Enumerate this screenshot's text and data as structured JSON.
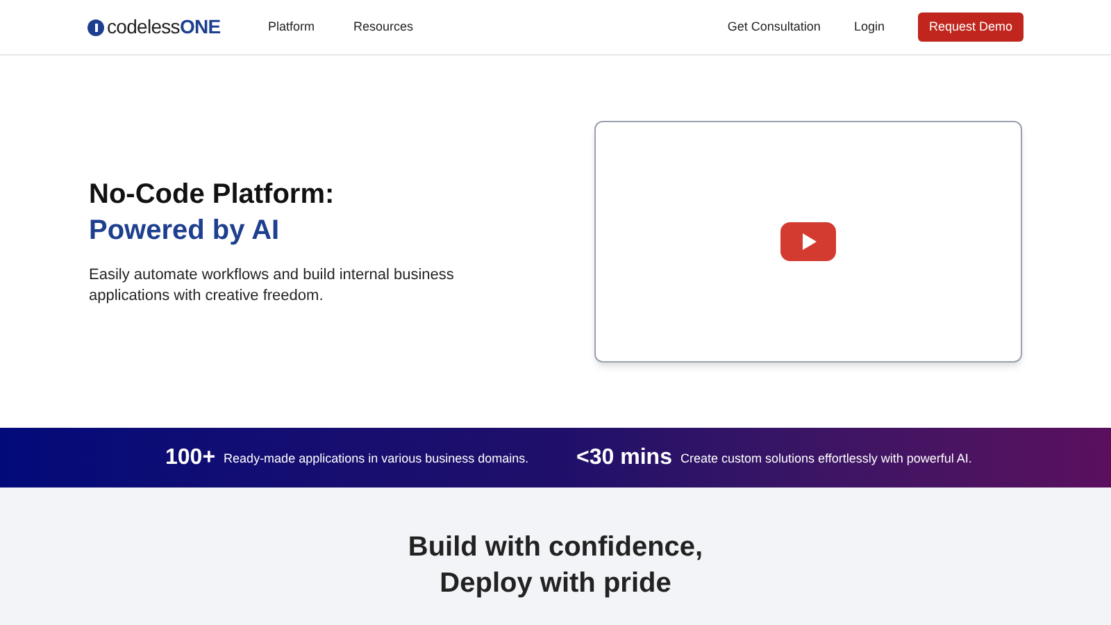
{
  "nav": {
    "logo": {
      "prefix": "codeless",
      "suffix": "ONE"
    },
    "links": [
      "Platform",
      "Resources"
    ],
    "right_links": [
      "Get Consultation",
      "Login"
    ],
    "cta": "Request Demo"
  },
  "hero": {
    "title": "No-Code Platform:",
    "highlight": "Powered by AI",
    "description": "Easily automate workflows and build internal business applications with creative freedom.",
    "video": {
      "kind": "video"
    }
  },
  "stats": [
    {
      "value": "100+",
      "text": "Ready-made applications in various business domains."
    },
    {
      "value": "<30 mins",
      "text": "Create custom solutions effortlessly with powerful AI."
    }
  ],
  "section": {
    "title_lines": [
      "Build with confidence,",
      "Deploy with pride"
    ]
  }
}
